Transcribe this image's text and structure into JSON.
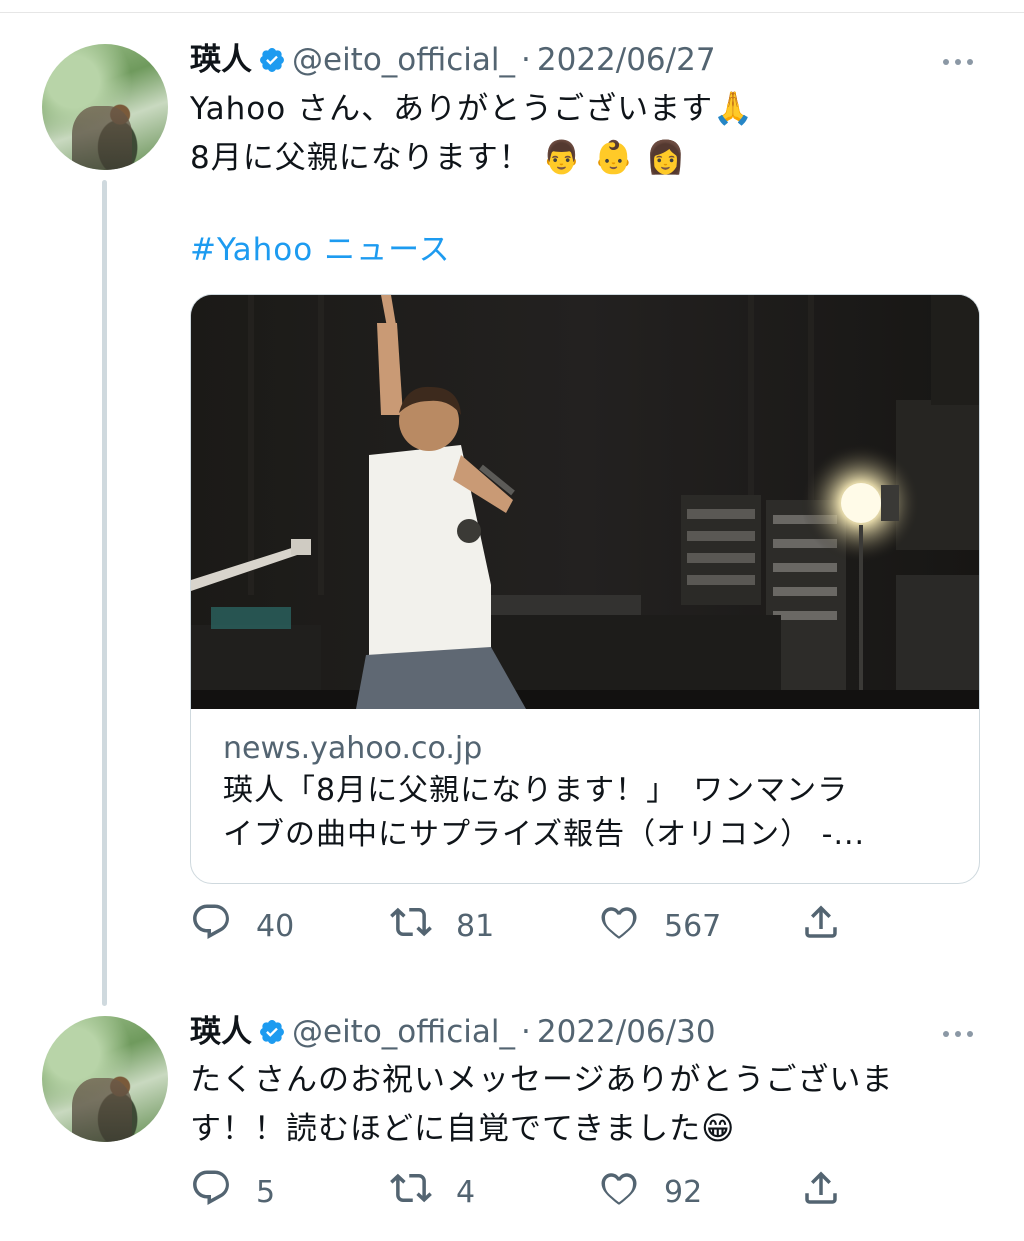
{
  "tweets": [
    {
      "author_name": "瑛人",
      "handle": "@eito_official_",
      "separator": "·",
      "date": "2022/06/27",
      "text_line1": "Yahoo さん、ありがとうございます",
      "text_line1_emoji": "🙏",
      "text_line2": "8月に父親になります！",
      "text_line2_emoji": "👨 👶 👩",
      "hashtag": "#Yahoo ニュース",
      "card": {
        "domain": "news.yahoo.co.jp",
        "title_line1": "瑛人「8月に父親になります！」　ワンマンラ",
        "title_line2": "イブの曲中にサプライズ報告（オリコン） -..."
      },
      "replies": "40",
      "retweets": "81",
      "likes": "567"
    },
    {
      "author_name": "瑛人",
      "handle": "@eito_official_",
      "separator": "·",
      "date": "2022/06/30",
      "text_line1": "たくさんのお祝いメッセージありがとうございま",
      "text_line2": "す！！読むほどに自覚でてきました",
      "text_line2_emoji": "😁",
      "replies": "5",
      "retweets": "4",
      "likes": "92"
    }
  ],
  "icons": [
    "verified-badge-icon",
    "more-icon",
    "reply-icon",
    "retweet-icon",
    "like-icon",
    "share-icon"
  ],
  "colors": {
    "link": "#1d9bf0",
    "verified": "#1d9bf0",
    "muted": "#536471",
    "text": "#0f1419",
    "thread_line": "#cfd9de"
  }
}
